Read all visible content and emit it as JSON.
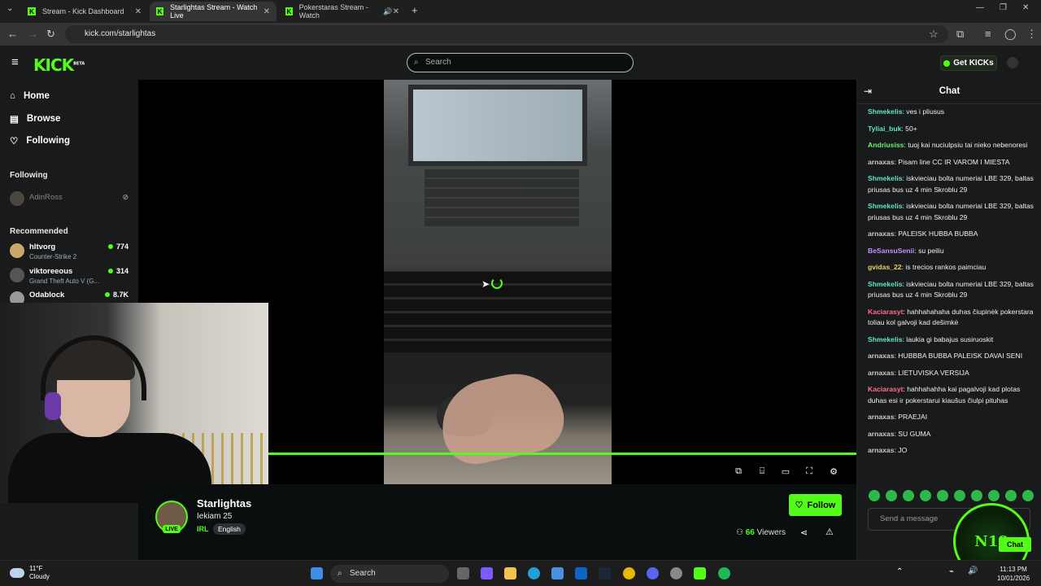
{
  "browser": {
    "tabs": [
      {
        "title": "Stream - Kick Dashboard",
        "active": false
      },
      {
        "title": "Starlightas Stream - Watch Live",
        "active": true
      },
      {
        "title": "Pokerstaras Stream - Watch",
        "active": false
      }
    ],
    "url": "kick.com/starlightas"
  },
  "header": {
    "logo": "KICK",
    "logo_badge": "BETA",
    "search_placeholder": "Search",
    "get_kicks": "Get KICKs"
  },
  "sidebar": {
    "nav": [
      {
        "label": "Home",
        "icon": "home-icon"
      },
      {
        "label": "Browse",
        "icon": "browse-icon"
      },
      {
        "label": "Following",
        "icon": "heart-icon"
      }
    ],
    "following_title": "Following",
    "following": [
      {
        "name": "AdinRoss",
        "offline": true
      }
    ],
    "recommended_title": "Recommended",
    "recommended": [
      {
        "name": "hltvorg",
        "game": "Counter-Strike 2",
        "viewers": "774"
      },
      {
        "name": "viktoreeous",
        "game": "Grand Theft Auto V (G...",
        "viewers": "314"
      },
      {
        "name": "Odablock",
        "game": "",
        "viewers": "8.7K"
      }
    ]
  },
  "stream": {
    "streamer": "Starlightas",
    "title": "Iekiam 25",
    "category": "IRL",
    "language": "English",
    "live_label": "LIVE",
    "follow_label": "Follow",
    "viewer_count": "66",
    "viewers_label": "Viewers"
  },
  "chat": {
    "title": "Chat",
    "input_placeholder": "Send a message",
    "chat_button": "Chat",
    "overlay_text": "N18",
    "messages": [
      {
        "user": "Shmekelis",
        "color": "#5ee6c6",
        "text": "ves i pliusus"
      },
      {
        "user": "Tyliai_buk",
        "color": "#5ee6c6",
        "text": "50+"
      },
      {
        "user": "Andriusiss",
        "color": "#6bf26b",
        "text": "tuoj kai nuciulpsiu tai nieko nebenoresi"
      },
      {
        "user": "arnaxas",
        "color": "#c9c9c9",
        "text": "Pisam line CC IR VAROM I MIESTA"
      },
      {
        "user": "Shmekelis",
        "color": "#5ee6c6",
        "text": "iskvieciau bolta numeriai LBE 329, baltas priusas bus uz 4 min Skroblu 29"
      },
      {
        "user": "Shmekelis",
        "color": "#5ee6c6",
        "text": "iskvieciau bolta numeriai LBE 329, baltas priusas bus uz 4 min Skroblu 29"
      },
      {
        "user": "arnaxas",
        "color": "#c9c9c9",
        "text": "PALEISK HUBBA BUBBA"
      },
      {
        "user": "BeSansuSenii",
        "color": "#c490ff",
        "text": "su peiliu"
      },
      {
        "user": "gvidas_22",
        "color": "#e7d65a",
        "text": "is trecios rankos paimciau"
      },
      {
        "user": "Shmekelis",
        "color": "#5ee6c6",
        "text": "iskvieciau bolta numeriai LBE 329, baltas priusas bus uz 4 min Skroblu 29"
      },
      {
        "user": "Kaciarasyt",
        "color": "#ff6e8a",
        "text": "hahhahahaha duhas čiupinėk pokerstara toliau kol galvoji kad dešimkė"
      },
      {
        "user": "Shmekelis",
        "color": "#5ee6c6",
        "text": "laukia gi babajus susiruoskit"
      },
      {
        "user": "arnaxas",
        "color": "#c9c9c9",
        "text": "HUBBBA BUBBA PALEISK DAVAI SENI"
      },
      {
        "user": "arnaxas",
        "color": "#c9c9c9",
        "text": "LIETUVISKA VERSIJA"
      },
      {
        "user": "Kaciarasyt",
        "color": "#ff6e8a",
        "text": "hahhahahha kai pagalvoji kad plotas duhas esi ir pokerstarui kiaušus čiulpi pituhas"
      },
      {
        "user": "arnaxas",
        "color": "#c9c9c9",
        "text": "PRAEJAI"
      },
      {
        "user": "arnaxas",
        "color": "#c9c9c9",
        "text": "SU GUMA"
      },
      {
        "user": "arnaxas",
        "color": "#c9c9c9",
        "text": "JO"
      }
    ]
  },
  "taskbar": {
    "temperature": "11°F",
    "weather": "Cloudy",
    "search": "Search",
    "time": "11:13 PM",
    "date": "10/01/2026"
  }
}
